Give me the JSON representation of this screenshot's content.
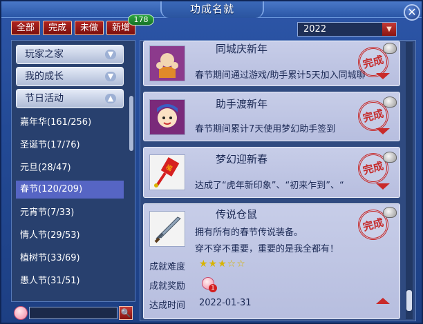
{
  "window": {
    "title": "功成名就",
    "close_symbol": "✕"
  },
  "filters": [
    {
      "label": "全部"
    },
    {
      "label": "完成"
    },
    {
      "label": "未做"
    },
    {
      "label": "新增"
    }
  ],
  "new_badge": "178",
  "year_select": {
    "value": "2022",
    "arrow_icon": "chevron-down-icon"
  },
  "categories": [
    {
      "label": "玩家之家",
      "state": "collapsed"
    },
    {
      "label": "我的成长",
      "state": "collapsed"
    },
    {
      "label": "节日活动",
      "state": "expanded"
    }
  ],
  "festivals": [
    {
      "label": "嘉年华(161/256)"
    },
    {
      "label": "圣诞节(17/76)"
    },
    {
      "label": "元旦(28/47)"
    },
    {
      "label": "春节(120/209)",
      "selected": true
    },
    {
      "label": "元宵节(7/33)"
    },
    {
      "label": "情人节(29/53)"
    },
    {
      "label": "植树节(33/69)"
    },
    {
      "label": "愚人节(31/51)"
    }
  ],
  "search": {
    "placeholder": "",
    "button_icon": "search-icon"
  },
  "achievements": [
    {
      "title": "同城庆新年",
      "description": "春节期间通过游戏/助手累计5天加入同城聊",
      "seal": "完成",
      "icon": "monk-icon"
    },
    {
      "title": "助手渡新年",
      "description": "春节期间累计7天使用梦幻助手签到",
      "seal": "完成",
      "icon": "assistant-icon"
    },
    {
      "title": "梦幻迎新春",
      "description": "达成了“虎年新印象”、“初来乍到”、“",
      "seal": "完成",
      "icon": "firecracker-icon"
    },
    {
      "title": "传说仓鼠",
      "description_lines": [
        "拥有所有的春节传说装备。",
        "穿不穿不重要，重要的是我全都有！"
      ],
      "seal": "完成",
      "icon": "sword-icon",
      "details": {
        "difficulty_label": "成就难度",
        "difficulty_stars": "★★★☆☆",
        "difficulty_value": 3,
        "difficulty_max": 5,
        "reward_label": "成就奖励",
        "reward_icon": "peach-icon",
        "reward_count": "1",
        "date_label": "达成时间",
        "date_value": "2022-01-31"
      }
    }
  ],
  "colors": {
    "accent_red": "#c62a2a",
    "badge_green": "#2fa640",
    "selected_row": "#5665c4",
    "panel_blue": "#2f4a80"
  }
}
